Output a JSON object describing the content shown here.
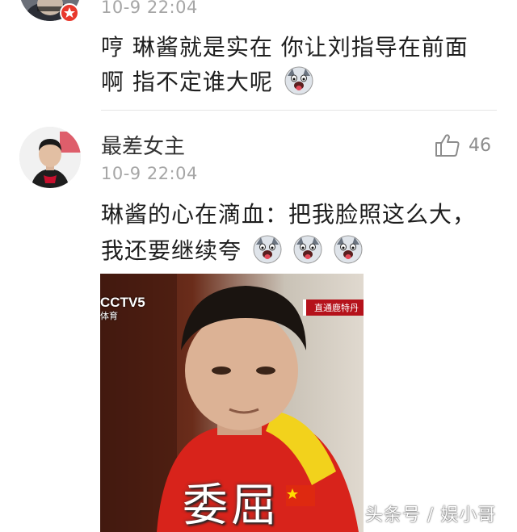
{
  "comment1": {
    "time": "10-9 22:04",
    "text_line1": "哼 琳酱就是实在 你让刘指导在前面",
    "text_line2": "啊 指不定谁大呢"
  },
  "comment2": {
    "username": "最差女主",
    "time": "10-9 22:04",
    "likes": "46",
    "text_line1": "琳酱的心在滴血：把我脸照这么大，",
    "text_line2": "我还要继续夸",
    "image": {
      "channel_logo": "CCTV5",
      "channel_sub": "体育",
      "banner": "直通鹿特丹",
      "caption": "委屈"
    }
  },
  "watermark": "头条号 / 娱小哥",
  "icons": {
    "like": "thumbs-up-icon",
    "emoji": "husky-laugh-emoji",
    "badge": "red-star-badge-icon"
  },
  "colors": {
    "time": "#a6a6a6",
    "divider": "#e6e6e6",
    "badge": "#e8382c"
  }
}
